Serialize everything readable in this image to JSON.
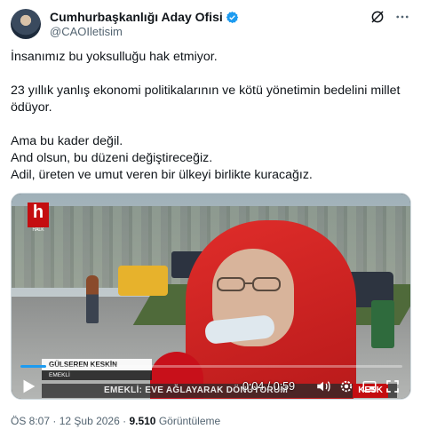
{
  "author": {
    "display_name": "Cumhurbaşkanlığı Aday Ofisi",
    "handle": "@CAOIletisim",
    "verified_color": "#1d9bf0"
  },
  "header_icons": [
    "grok-icon",
    "more-icon"
  ],
  "tweet": {
    "paragraphs": [
      "İnsanımız bu yoksulluğu hak etmiyor.",
      "23 yıllık yanlış ekonomi politikalarının ve kötü yönetimin bedelini millet ödüyor.",
      "Ama bu kader değil.\nAnd olsun, bu düzeni değiştireceğiz.\nAdil, üreten ve umut veren bir ülkeyi birlikte kuracağız."
    ]
  },
  "video": {
    "channel_logo": "h",
    "channel_logo_sub": "HALK",
    "lower_third_name": "GÜLSEREN KESKİN",
    "lower_third_sub": "EMEKLİ",
    "ticker_text": "EMEKLİ: EVE AĞLAYARAK DÖNÜYORUM",
    "ticker_tag": "KESK",
    "time_display": "0:04 / 0:59",
    "progress_fraction": 0.068,
    "accent": "#1d9bf0",
    "controls": [
      "play-icon",
      "volume-icon",
      "settings-icon",
      "pip-icon",
      "fullscreen-icon"
    ]
  },
  "meta": {
    "time": "ÖS 8:07",
    "separator": " · ",
    "date": "12 Şub 2026",
    "views_count": "9.510",
    "views_label": "Görüntüleme"
  }
}
